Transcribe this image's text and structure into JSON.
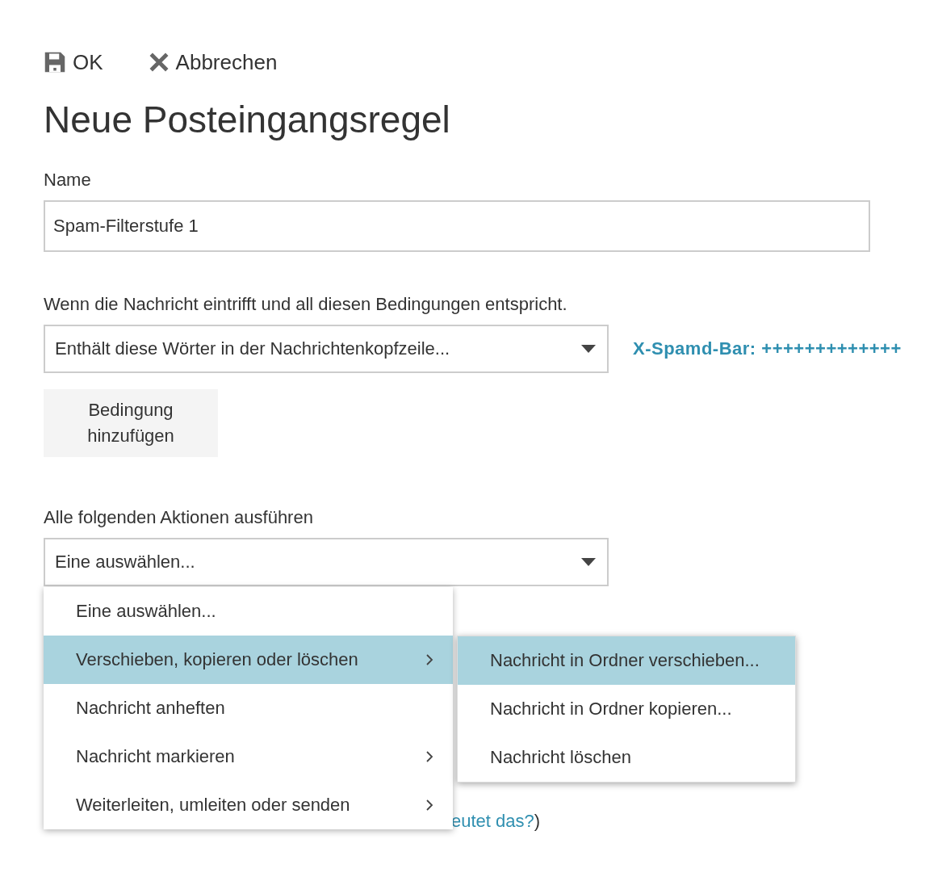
{
  "toolbar": [
    {
      "kind": "save",
      "label": "OK"
    },
    {
      "kind": "cancel",
      "label": "Abbrechen"
    }
  ],
  "title": "Neue Posteingangsregel",
  "name_field": {
    "label": "Name",
    "value": "Spam-Filterstufe 1"
  },
  "condition": {
    "label": "Wenn die Nachricht eintrifft und all diesen Bedingungen entspricht.",
    "select_value": "Enthält diese Wörter in der Nachrichtenkopfzeile...",
    "link": "X-Spamd-Bar: +++++++++++++",
    "add_button": "Bedingung hinzufügen"
  },
  "action": {
    "label": "Alle folgenden Aktionen ausführen",
    "select_value": "Eine auswählen..."
  },
  "menu": {
    "items": [
      {
        "label": "Eine auswählen...",
        "selected": false,
        "has_submenu": false
      },
      {
        "label": "Verschieben, kopieren oder löschen",
        "selected": true,
        "has_submenu": true
      },
      {
        "label": "Nachricht anheften",
        "selected": false,
        "has_submenu": false
      },
      {
        "label": "Nachricht markieren",
        "selected": false,
        "has_submenu": true
      },
      {
        "label": "Weiterleiten, umleiten oder senden",
        "selected": false,
        "has_submenu": true
      }
    ]
  },
  "submenu": {
    "items": [
      {
        "label": "Nachricht in Ordner verschieben...",
        "selected": true
      },
      {
        "label": "Nachricht in Ordner kopieren...",
        "selected": false
      },
      {
        "label": "Nachricht löschen",
        "selected": false
      }
    ]
  },
  "covered_row": {
    "link_fragment": "eutet das?",
    "closing": ")"
  }
}
